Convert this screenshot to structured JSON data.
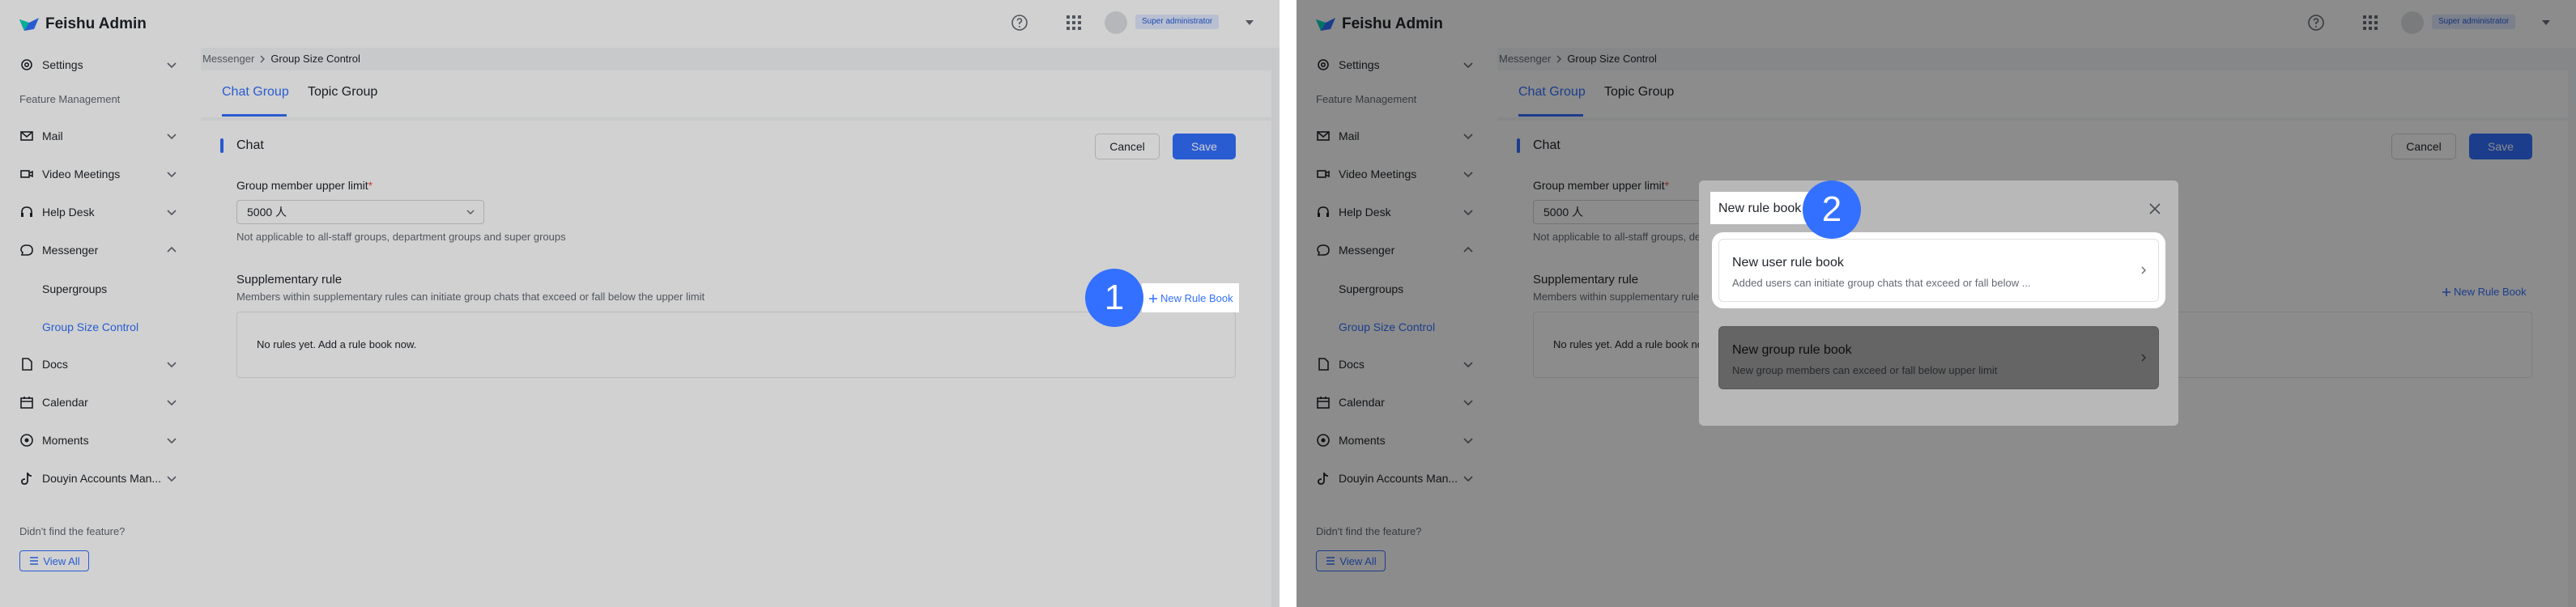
{
  "app": {
    "title": "Feishu Admin",
    "role_badge": "Super administrator"
  },
  "sidebar": {
    "settings": "Settings",
    "section": "Feature Management",
    "items": [
      {
        "label": "Mail",
        "icon": "mail-icon"
      },
      {
        "label": "Video Meetings",
        "icon": "video-icon"
      },
      {
        "label": "Help Desk",
        "icon": "headset-icon"
      },
      {
        "label": "Messenger",
        "icon": "chat-icon"
      },
      {
        "label": "Docs",
        "icon": "docs-icon"
      },
      {
        "label": "Calendar",
        "icon": "calendar-icon"
      },
      {
        "label": "Moments",
        "icon": "moments-icon"
      },
      {
        "label": "Douyin Accounts Man...",
        "icon": "douyin-icon"
      }
    ],
    "sub_items": [
      "Supergroups",
      "Group Size Control"
    ],
    "hint": "Didn't find the feature?",
    "view_all": "View All"
  },
  "breadcrumb": {
    "parent": "Messenger",
    "current": "Group Size Control"
  },
  "tabs": [
    "Chat Group",
    "Topic Group"
  ],
  "card": {
    "title": "Chat",
    "cancel": "Cancel",
    "save": "Save",
    "limit_label": "Group member upper limit",
    "required_mark": "*",
    "limit_value": "5000 人",
    "limit_hint": "Not applicable to all-staff groups, department groups and super groups",
    "supp_title": "Supplementary rule",
    "supp_desc": "Members within supplementary rules can initiate group chats that exceed or fall below the upper limit",
    "new_rule_button": "New Rule Book",
    "empty_text": "No rules yet. Add a rule book now."
  },
  "modal": {
    "title": "New rule book",
    "options": [
      {
        "title": "New user rule book",
        "desc": "Added users can initiate group chats that exceed or fall below ..."
      },
      {
        "title": "New group rule book",
        "desc": "New group members can exceed or fall below upper limit"
      }
    ]
  },
  "steps": [
    "1",
    "2"
  ],
  "colors": {
    "accent": "#3370ff",
    "badge": "#3370ff"
  }
}
